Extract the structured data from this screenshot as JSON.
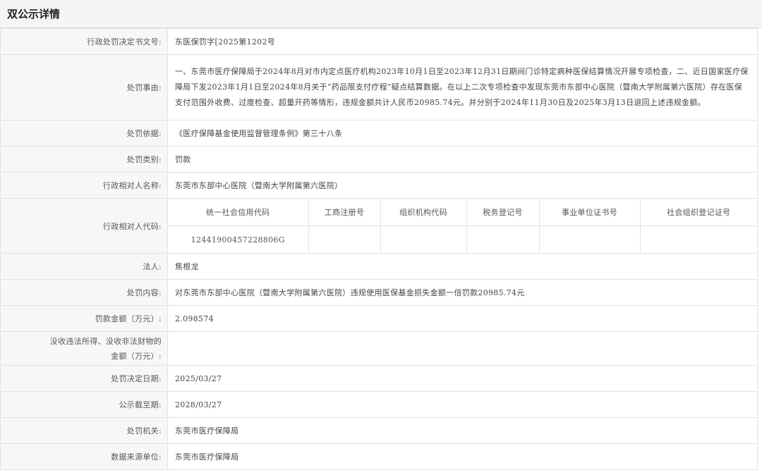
{
  "header": {
    "title": "双公示详情"
  },
  "rows": {
    "decision_no": {
      "label": "行政处罚决定书文号:",
      "value": "东医保罚字[2025第1202号"
    },
    "reason": {
      "label": "处罚事由:",
      "value": "一、东莞市医疗保障局于2024年8月对市内定点医疗机构2023年10月1日至2023年12月31日期间门诊特定病种医保结算情况开展专项检查，二、近日国家医疗保障局下发2023年1月1日至2024年8月关于“药品限支付疗程”疑点结算数据。在以上二次专项检查中发现东莞市东部中心医院（暨南大学附属第六医院）存在医保支付范围外收费、过度检查、超量开药等情形，违规金额共计人民币20985.74元。并分别于2024年11月30日及2025年3月13日退回上述违规金额。"
    },
    "basis": {
      "label": "处罚依据:",
      "value": "《医疗保障基金使用监督管理条例》第三十八条"
    },
    "category": {
      "label": "处罚类别:",
      "value": "罚款"
    },
    "party_name": {
      "label": "行政相对人名称:",
      "value": "东莞市东部中心医院（暨南大学附属第六医院）"
    },
    "party_code": {
      "label": "行政相对人代码:",
      "headers": [
        "统一社会信用代码",
        "工商注册号",
        "组织机构代码",
        "税务登记号",
        "事业单位证书号",
        "社会组织登记证号"
      ],
      "values": [
        "12441900457228806G",
        "",
        "",
        "",
        "",
        ""
      ]
    },
    "legal_person": {
      "label": "法人:",
      "value": "焦根龙"
    },
    "content": {
      "label": "处罚内容:",
      "value": "对东莞市东部中心医院（暨南大学附属第六医院）违规使用医保基金损失金额一倍罚款20985.74元"
    },
    "fine": {
      "label": "罚款金额（万元）:",
      "value": "2.098574"
    },
    "confiscation": {
      "label_line1": "没收违法所得、没收非法财物的",
      "label_line2": "金额（万元）:",
      "value": ""
    },
    "decision_date": {
      "label": "处罚决定日期:",
      "value": "2025/03/27"
    },
    "publicity_deadline": {
      "label": "公示截至期:",
      "value": "2028/03/27"
    },
    "authority": {
      "label": "处罚机关:",
      "value": "东莞市医疗保障局"
    },
    "data_source": {
      "label": "数据来源单位:",
      "value": "东莞市医疗保障局"
    }
  }
}
